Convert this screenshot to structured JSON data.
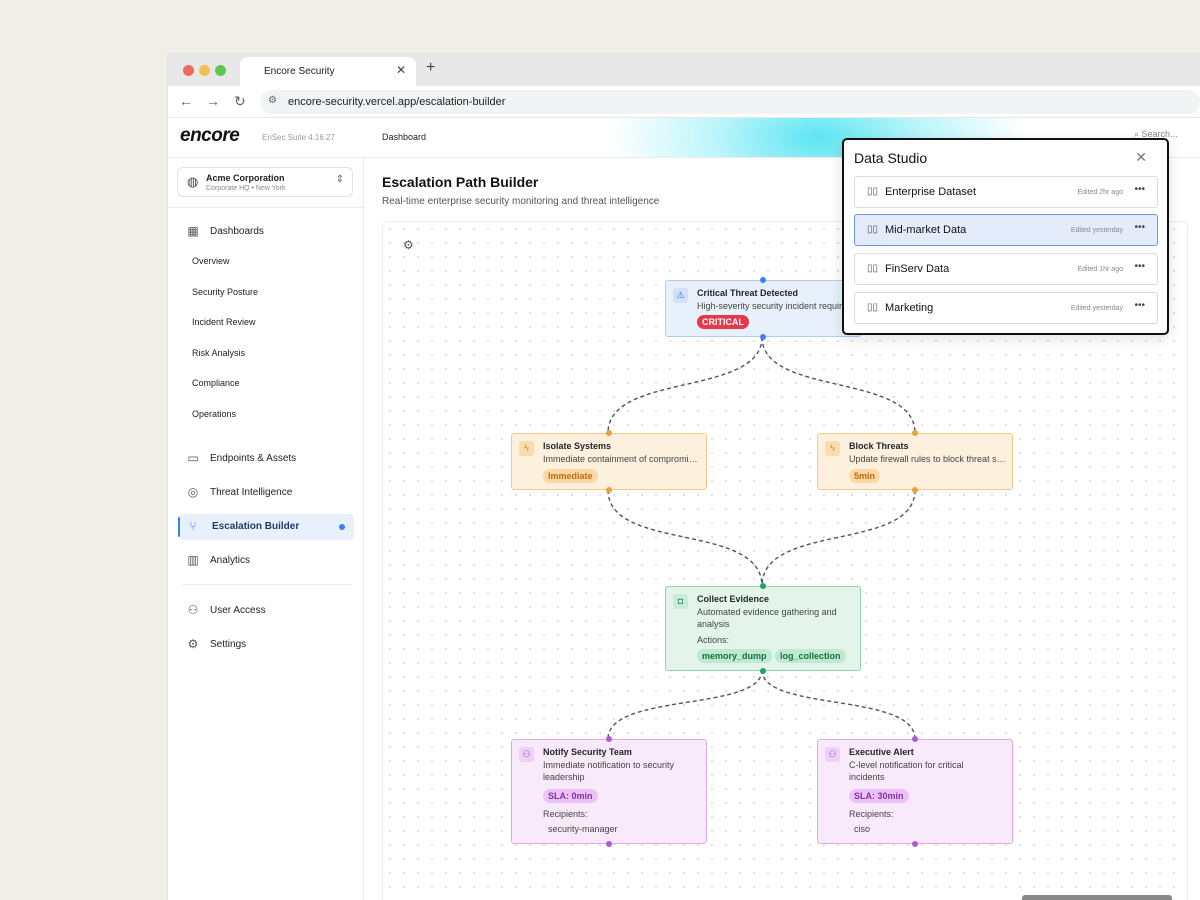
{
  "browser": {
    "tab_title": "Encore Security",
    "tab_close": "✕",
    "new_tab": "+",
    "url": "encore-security.vercel.app/escalation-builder",
    "nav": {
      "back": "←",
      "forward": "→",
      "reload": "↻"
    }
  },
  "header": {
    "logo": "encore",
    "version": "EnSec Suite 4.16.27",
    "breadcrumb": "Dashboard",
    "search_placeholder": "Search..."
  },
  "org": {
    "name": "Acme Corporation",
    "location": "Corporate HQ • New York"
  },
  "sidebar": {
    "dashboards": "Dashboards",
    "subitems": [
      "Overview",
      "Security Posture",
      "Incident Review",
      "Risk Analysis",
      "Compliance",
      "Operations"
    ],
    "items": [
      "Endpoints & Assets",
      "Threat Intelligence",
      "Escalation Builder",
      "Analytics"
    ],
    "bottom": [
      "User Access",
      "Settings"
    ],
    "active": "Escalation Builder"
  },
  "page": {
    "title": "Escalation Path Builder",
    "subtitle": "Real-time enterprise security monitoring and threat intelligence"
  },
  "nodes": {
    "critical": {
      "title": "Critical Threat Detected",
      "desc": "High-severity security incident requires immediate response",
      "badge": "CRITICAL"
    },
    "isolate": {
      "title": "Isolate Systems",
      "desc": "Immediate containment of compromised systems",
      "badge": "Immediate"
    },
    "block": {
      "title": "Block Threats",
      "desc": "Update firewall rules to block threat sources",
      "badge": "5min"
    },
    "collect": {
      "title": "Collect Evidence",
      "desc": "Automated evidence gathering and analysis",
      "actions_label": "Actions:",
      "actions": [
        "memory_dump",
        "log_collection"
      ]
    },
    "notify": {
      "title": "Notify Security Team",
      "desc": "Immediate notification to security leadership",
      "badge": "SLA: 0min",
      "recipients_label": "Recipients:",
      "recipient": "security-manager"
    },
    "exec": {
      "title": "Executive Alert",
      "desc": "C-level notification for critical incidents",
      "badge": "SLA: 30min",
      "recipients_label": "Recipients:",
      "recipient": "ciso"
    }
  },
  "data_studio": {
    "title": "Data Studio",
    "rows": [
      {
        "name": "Enterprise Dataset",
        "time": "Edited 2hr ago"
      },
      {
        "name": "Mid-market Data",
        "time": "Edited yesterday"
      },
      {
        "name": "FinServ Data",
        "time": "Edited 1hr ago"
      },
      {
        "name": "Marketing",
        "time": "Edited yesterday"
      }
    ],
    "selected": "Mid-market Data"
  },
  "colors": {
    "accent": "#3b82f6",
    "critical": "#e5394b",
    "orange": "#e8a23c",
    "green": "#1fa562",
    "purple": "#b05ad0"
  }
}
